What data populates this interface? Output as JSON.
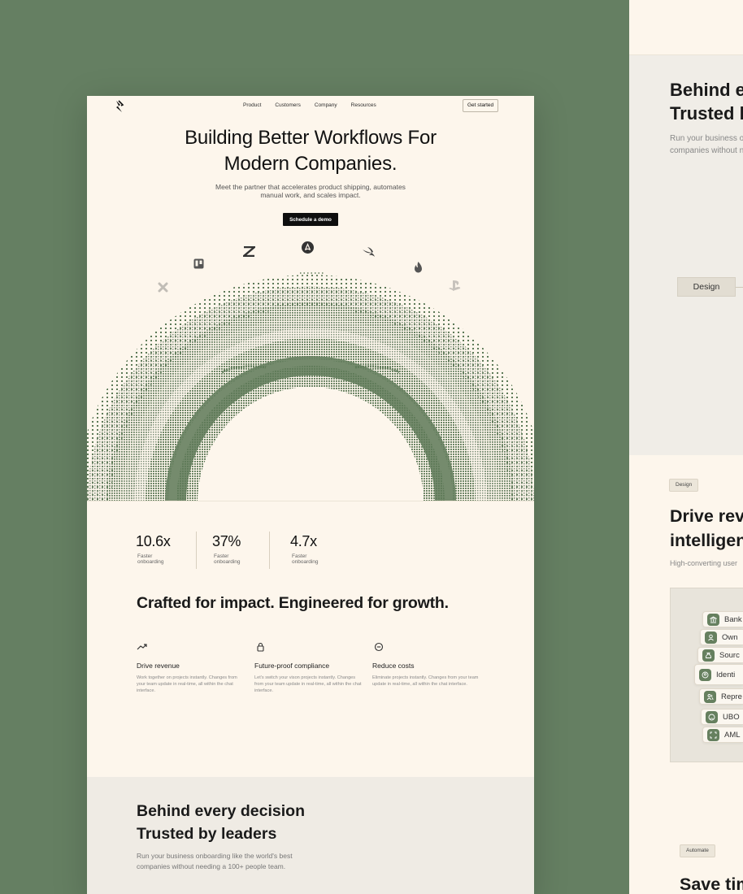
{
  "nav": {
    "links": [
      "Product",
      "Customers",
      "Company",
      "Resources"
    ],
    "cta": "Get started"
  },
  "hero": {
    "title_line1": "Building Better Workflows For",
    "title_line2": "Modern Companies.",
    "subtitle_line1": "Meet the partner that accelerates product shipping, automates",
    "subtitle_line2": "manual work, and scales impact.",
    "button": "Schedule a demo"
  },
  "brands": [
    "x-shape-icon",
    "trello-icon",
    "zendesk-icon",
    "airbnb-icon",
    "swift-icon",
    "tinder-icon",
    "playstation-icon"
  ],
  "stats": [
    {
      "value": "10.6x",
      "label": "Faster onboarding"
    },
    {
      "value": "37%",
      "label": "Faster onboarding"
    },
    {
      "value": "4.7x",
      "label": "Faster onboarding"
    }
  ],
  "crafted_heading": "Crafted for impact. Engineered for growth.",
  "features": [
    {
      "icon": "trending-up-icon",
      "title": "Drive revenue",
      "desc": "Work together on projects instantly. Changes from your team update in real-time, all within the chat interface."
    },
    {
      "icon": "lock-icon",
      "title": "Future-proof compliance",
      "desc": "Let's switch your vison projects instantly. Changes from your team update in real-time, all within the chat interface."
    },
    {
      "icon": "minus-circle-icon",
      "title": "Reduce costs",
      "desc": "Eliminate projects instantly. Changes from your team update in real-time, all within the chat interface."
    }
  ],
  "behind": {
    "line1": "Behind every decision",
    "line2": "Trusted by leaders",
    "sub_line1": "Run your business onboarding like the world's best",
    "sub_line2": "companies without needing a 100+ people team."
  },
  "right_panel": {
    "behind_line1": "Behind ev",
    "behind_line2": "Trusted b",
    "sub_line1": "Run your business on",
    "sub_line2": "companies without ne",
    "design_chip": "Design",
    "tag_design": "Design",
    "drive_line1": "Drive reve",
    "drive_line2": "intelligen",
    "drive_sub": "High-converting user",
    "list_items": [
      "Bank",
      "Own",
      "Sourc",
      "Identi",
      "Repre",
      "UBO",
      "AML"
    ],
    "tag_automate": "Automate",
    "save_heading": "Save tim"
  },
  "colors": {
    "background": "#657f62",
    "card": "#fdf6ec",
    "accent": "#66805f"
  }
}
